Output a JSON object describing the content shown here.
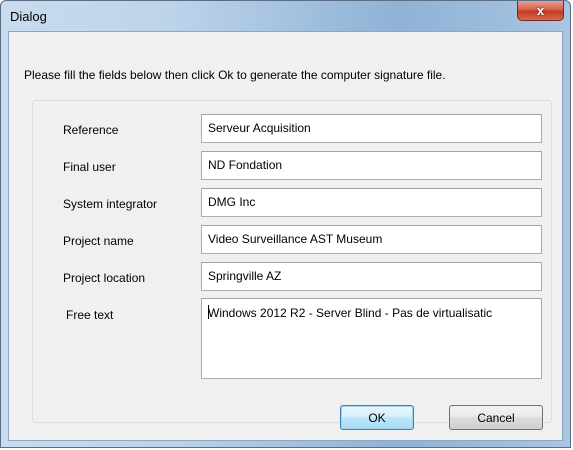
{
  "window": {
    "title": "Dialog",
    "close_glyph": "x"
  },
  "instructions": "Please fill the fields below then click Ok to generate the computer signature file.",
  "fields": [
    {
      "label": "Reference",
      "value": "Serveur Acquisition"
    },
    {
      "label": "Final user",
      "value": "ND Fondation"
    },
    {
      "label": "System integrator",
      "value": "DMG Inc"
    },
    {
      "label": "Project name",
      "value": "Video Surveillance AST Museum"
    },
    {
      "label": "Project location",
      "value": "Springville AZ"
    },
    {
      "label": "Free text",
      "value": "Windows 2012 R2 - Server Blind -  Pas de virtualisatic"
    }
  ],
  "buttons": {
    "ok": "OK",
    "cancel": "Cancel"
  },
  "icons": {
    "close": "close-icon"
  }
}
